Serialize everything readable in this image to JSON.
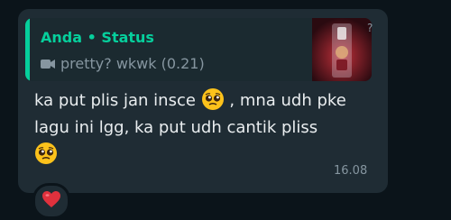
{
  "reply_quote": {
    "author": "Anda",
    "separator": "•",
    "context": "Status",
    "caption": "pretty? wkwk (0.21)"
  },
  "message": {
    "part1": "ka put plis jan insce",
    "part2": ", mna udh pke lagu ini lgg, ka put udh cantik pliss",
    "timestamp": "16.08"
  },
  "reaction": {
    "emoji_name": "red-heart-emoji"
  },
  "icons": {
    "quote_media": "video-camera-icon",
    "emoji": "pleading-face-emoji"
  },
  "colors": {
    "background": "#0b141a",
    "bubble": "#1f2c34",
    "accent": "#06cf9c",
    "text": "#e9edef",
    "muted": "#8696a0"
  }
}
